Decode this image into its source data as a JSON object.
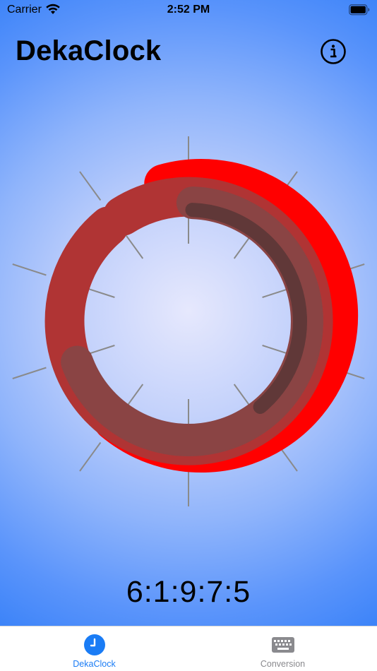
{
  "status_bar": {
    "carrier": "Carrier",
    "time": "2:52 PM"
  },
  "header": {
    "title": "DekaClock",
    "info_icon": "info-icon"
  },
  "dial": {
    "tick_count": 10,
    "arc_colors": [
      "#ff0000",
      "#b03434",
      "#8a4444",
      "#603838"
    ],
    "tick_color": "#8a8a8a"
  },
  "readout": {
    "value": "6:1:9:7:5"
  },
  "tab_bar": {
    "active_color": "#1a7cf5",
    "inactive_color": "#8a8a8e",
    "tabs": [
      {
        "label": "DekaClock",
        "icon": "clock-icon",
        "active": true
      },
      {
        "label": "Conversion",
        "icon": "keyboard-icon",
        "active": false
      }
    ]
  }
}
